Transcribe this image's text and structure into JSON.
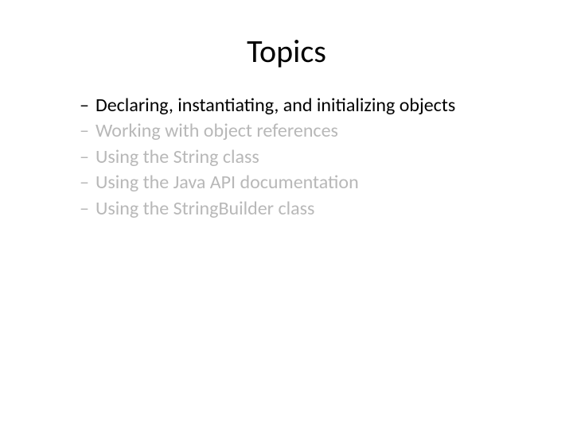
{
  "title": "Topics",
  "items": [
    {
      "text": "Declaring, instantiating, and initializing objects",
      "active": true
    },
    {
      "text": "Working with object references",
      "active": false
    },
    {
      "text": "Using the String class",
      "active": false
    },
    {
      "text": "Using the Java API documentation",
      "active": false
    },
    {
      "text": "Using the StringBuilder class",
      "active": false
    }
  ]
}
